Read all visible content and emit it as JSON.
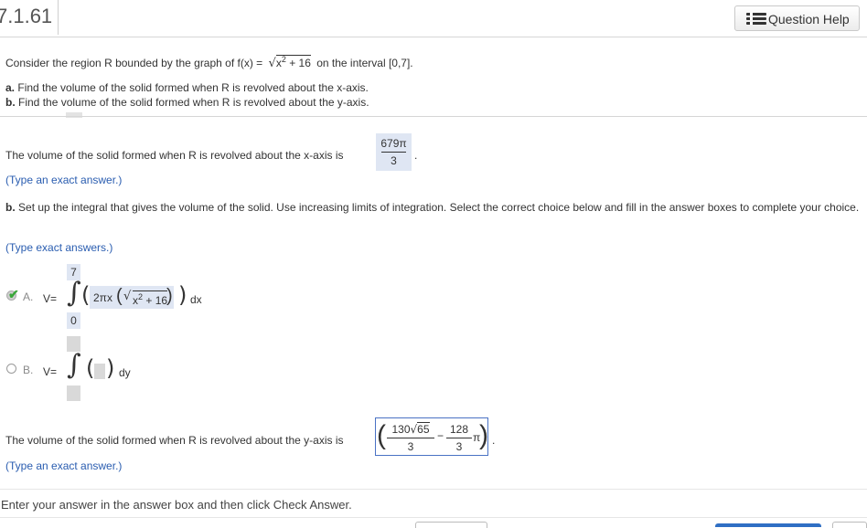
{
  "header": {
    "question_number": "7.1.61",
    "help_label": "Question Help"
  },
  "problem": {
    "statement": "Consider the region R bounded by the graph of f(x) =",
    "func_radicand": "x",
    "func_exp": "2",
    "func_const": "+ 16",
    "interval": "on the interval [0,7].",
    "part_a_label": "a.",
    "part_a_text": "Find the volume of the solid formed when R is revolved about the x-axis.",
    "part_b_label": "b.",
    "part_b_text": "Find the volume of the solid formed when R is revolved about the y-axis."
  },
  "answer_a": {
    "text": "The volume of the solid formed when R is revolved about the x-axis is",
    "numerator": "679π",
    "denominator": "3",
    "trail": ".",
    "hint": "(Type an exact answer.)"
  },
  "part_b_setup": {
    "label": "b.",
    "text": "Set up the integral that gives the volume of the solid. Use increasing limits of integration. Select the correct choice below and fill in the answer boxes to complete your choice.",
    "hint": "(Type exact answers.)"
  },
  "choice_a": {
    "label": "A.",
    "v_eq": "V=",
    "upper": "7",
    "lower": "0",
    "integrand_coef": "2πx",
    "integrand_var": "x",
    "integrand_exp": "2",
    "integrand_const": "+ 16",
    "dvar": "dx"
  },
  "choice_b": {
    "label": "B.",
    "v_eq": "V=",
    "dvar": "dy"
  },
  "answer_b": {
    "text": "The volume of the solid formed when R is revolved about the y-axis is",
    "num1_coef": "130",
    "num1_rad": "65",
    "den1": "3",
    "minus": "−",
    "num2": "128",
    "den2": "3",
    "pi": "π",
    "trail": ".",
    "hint": "(Type an exact answer.)"
  },
  "footer": {
    "instruction": "Enter your answer in the answer box and then click Check Answer."
  }
}
